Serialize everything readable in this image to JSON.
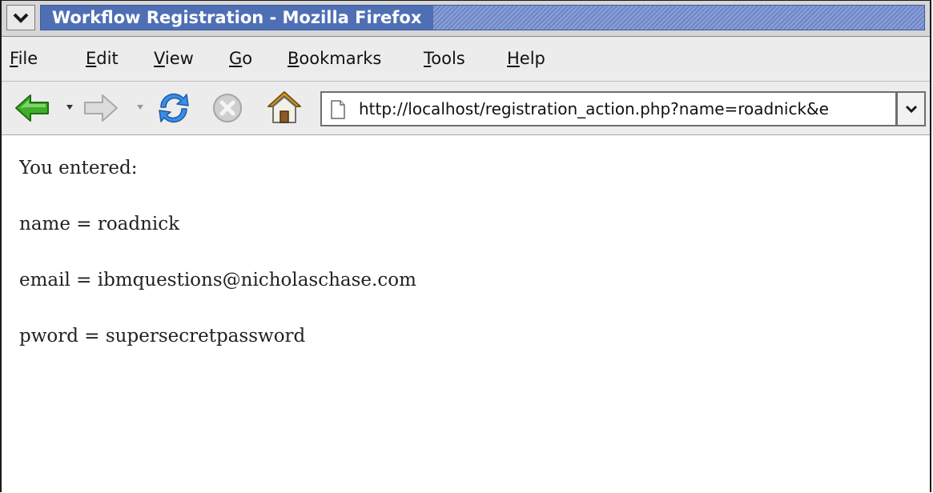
{
  "window": {
    "title": "Workflow Registration - Mozilla Firefox"
  },
  "menubar": {
    "items": [
      {
        "accel": "F",
        "rest": "ile"
      },
      {
        "accel": "E",
        "rest": "dit"
      },
      {
        "accel": "V",
        "rest": "iew"
      },
      {
        "accel": "G",
        "rest": "o"
      },
      {
        "accel": "B",
        "rest": "ookmarks"
      },
      {
        "accel": "T",
        "rest": "ools"
      },
      {
        "accel": "H",
        "rest": "elp"
      }
    ]
  },
  "toolbar": {
    "icons": [
      "back-arrow-icon",
      "forward-arrow-icon",
      "reload-icon",
      "stop-icon",
      "home-icon"
    ],
    "url": "http://localhost/registration_action.php?name=roadnick&e"
  },
  "content": {
    "lines": [
      "You entered:",
      "name = roadnick",
      "email = ibmquestions@nicholaschase.com",
      "pword = supersecretpassword"
    ]
  },
  "colors": {
    "title_bar": "#4f6fb5",
    "back_arrow": "#3fae2a"
  }
}
